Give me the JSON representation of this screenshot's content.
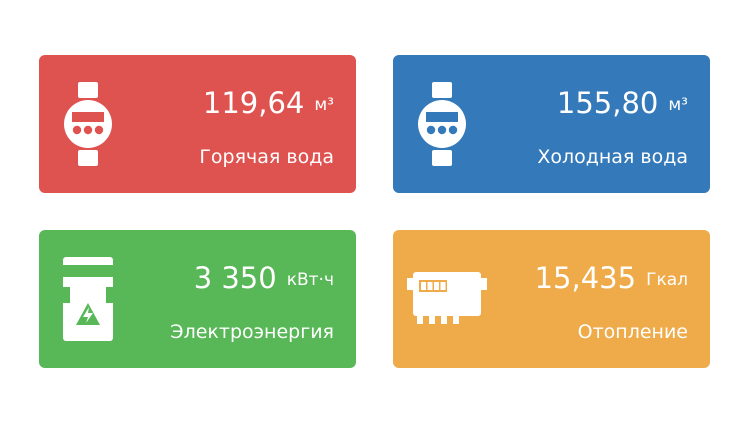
{
  "colors": {
    "hot_water": "#DE5350",
    "cold_water": "#3479BA",
    "electricity": "#58B756",
    "heating": "#EFAB4A"
  },
  "cards": [
    {
      "icon": "water-meter-icon",
      "value": "119,64",
      "unit": "м³",
      "label": "Горячая вода"
    },
    {
      "icon": "water-meter-icon",
      "value": "155,80",
      "unit": "м³",
      "label": "Холодная вода"
    },
    {
      "icon": "electricity-meter-icon",
      "value": "3 350",
      "unit": "кВт·ч",
      "label": "Электроэнергия"
    },
    {
      "icon": "heat-meter-icon",
      "value": "15,435",
      "unit": "Гкал",
      "label": "Отопление"
    }
  ]
}
